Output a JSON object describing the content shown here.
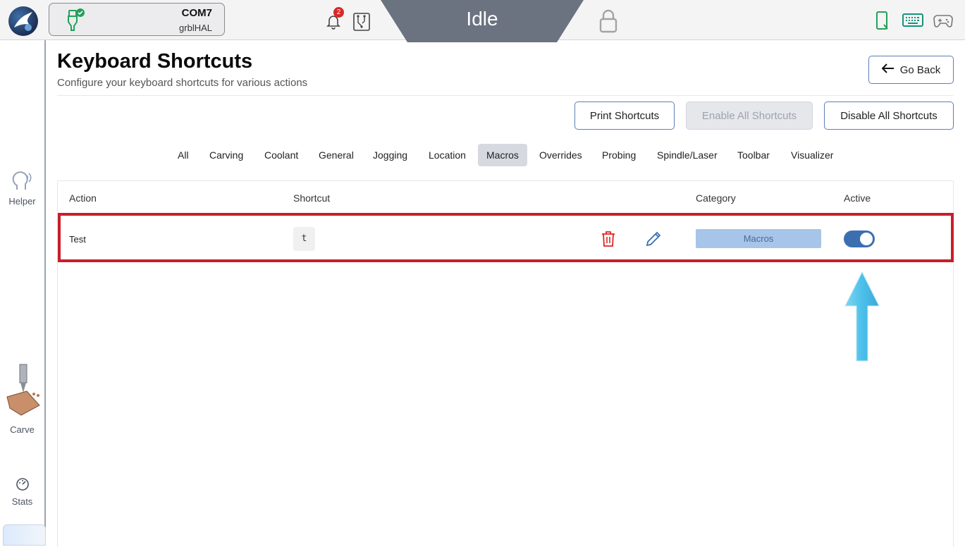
{
  "topbar": {
    "port": "COM7",
    "firmware": "grblHAL",
    "notification_count": "2",
    "machine_state": "Idle",
    "colors": {
      "state_bg": "#6b7280",
      "connected": "#22a05a",
      "badge": "#dc2626"
    },
    "icons": [
      "logo-icon",
      "usb-connected-icon",
      "bell-icon",
      "circuit-icon",
      "lock-icon",
      "phone-icon",
      "keyboard-icon",
      "gamepad-icon"
    ]
  },
  "sidebar": {
    "items": [
      {
        "label": "Helper",
        "icon": "helper-head-icon"
      },
      {
        "label": "Carve",
        "icon": "carve-tool-icon"
      },
      {
        "label": "Stats",
        "icon": "gauge-icon"
      }
    ]
  },
  "page": {
    "title": "Keyboard Shortcuts",
    "subtitle": "Configure your keyboard shortcuts for various actions",
    "go_back": "Go Back"
  },
  "actions": {
    "print": "Print Shortcuts",
    "enable_all": "Enable All Shortcuts",
    "disable_all": "Disable All Shortcuts"
  },
  "tabs": [
    "All",
    "Carving",
    "Coolant",
    "General",
    "Jogging",
    "Location",
    "Macros",
    "Overrides",
    "Probing",
    "Spindle/Laser",
    "Toolbar",
    "Visualizer"
  ],
  "active_tab": "Macros",
  "table": {
    "headers": {
      "action": "Action",
      "shortcut": "Shortcut",
      "category": "Category",
      "active": "Active"
    },
    "rows": [
      {
        "action": "Test",
        "shortcut": "t",
        "category": "Macros",
        "active": true
      }
    ]
  },
  "annotations": {
    "highlight_color": "#c81e2a",
    "arrow_color": "#56c2ea"
  }
}
